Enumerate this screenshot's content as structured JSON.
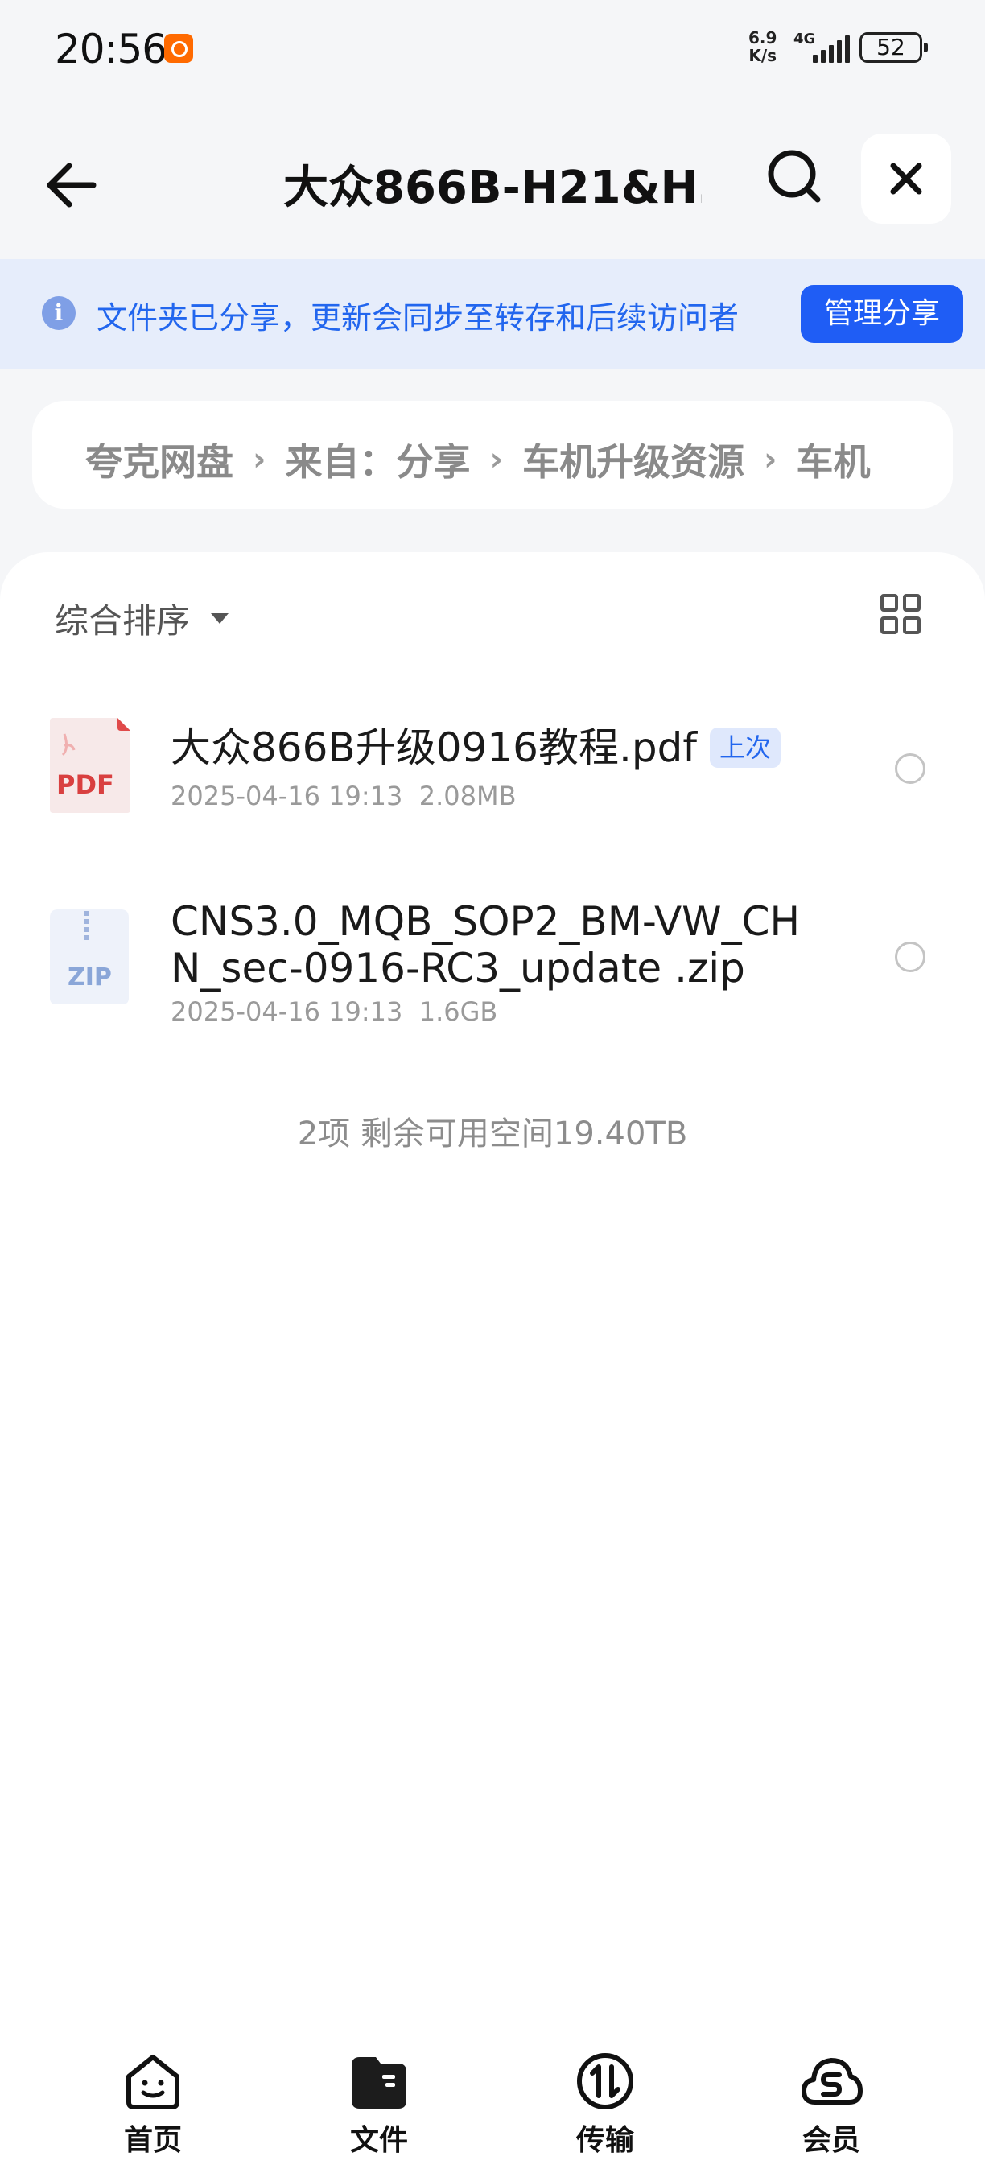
{
  "status_bar": {
    "time": "20:56",
    "speed_value": "6.9",
    "speed_unit": "K/s",
    "network": "4G",
    "battery": "52"
  },
  "header": {
    "title": "大众866B-H21&H…"
  },
  "banner": {
    "text": "文件夹已分享，更新会同步至转存和后续访问者",
    "manage_label": "管理分享"
  },
  "breadcrumb": {
    "items": [
      "夸克网盘",
      "来自：分享",
      "车机升级资源",
      "车机"
    ]
  },
  "toolbar": {
    "sort_label": "综合排序"
  },
  "files": [
    {
      "icon": "pdf-file-icon",
      "icon_text": "PDF",
      "name": "大众866B升级0916教程.pdf",
      "badge": "上次",
      "date": "2025-04-16 19:13",
      "size": "2.08MB"
    },
    {
      "icon": "zip-file-icon",
      "icon_text": "ZIP",
      "name_line1": "CNS3.0_MQB_SOP2_BM-VW_CH",
      "name_line2": "N_sec-0916-RC3_update .zip",
      "date": "2025-04-16 19:13",
      "size": "1.6GB"
    }
  ],
  "summary": "2项 剩余可用空间19.40TB",
  "bottom_nav": [
    {
      "label": "首页",
      "icon": "home-face-icon"
    },
    {
      "label": "文件",
      "icon": "folder-icon"
    },
    {
      "label": "传输",
      "icon": "transfer-icon"
    },
    {
      "label": "会员",
      "icon": "cloud-member-icon"
    }
  ],
  "colors": {
    "accent": "#1f5df5",
    "banner_bg": "#e6edfb",
    "banner_text": "#2266ee",
    "pdf_red": "#e04a4a",
    "zip_blue": "#8aa6d8"
  }
}
